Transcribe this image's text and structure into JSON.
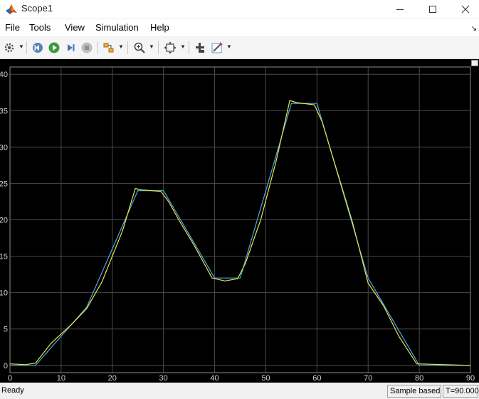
{
  "window": {
    "title": "Scope1"
  },
  "menu": {
    "items": [
      "File",
      "Tools",
      "View",
      "Simulation",
      "Help"
    ]
  },
  "toolbar": {
    "icons": [
      "gear-icon",
      "step-back-icon",
      "run-icon",
      "step-forward-icon",
      "stop-icon",
      "highlight-block-icon",
      "zoom-icon",
      "fit-to-view-icon",
      "cursor-measure-icon",
      "style-icon"
    ]
  },
  "colors": {
    "plot_bg": "#000000",
    "grid": "#4a4a4a",
    "axis": "#8c8c8c",
    "tick_text": "#d2d2d2",
    "series1": "#4da6e8",
    "series2": "#e6e64c"
  },
  "status": {
    "left": "Ready",
    "mode": "Sample based",
    "time": "T=90.000"
  },
  "chart_data": {
    "type": "line",
    "xlim": [
      0,
      90
    ],
    "ylim": [
      -1,
      41
    ],
    "xticks": [
      0,
      10,
      20,
      30,
      40,
      50,
      60,
      70,
      80,
      90
    ],
    "yticks": [
      0,
      5,
      10,
      15,
      20,
      25,
      30,
      35,
      40
    ],
    "grid": true,
    "series": [
      {
        "color": "#4da6e8",
        "x": [
          0,
          5,
          15,
          25,
          30,
          40,
          45,
          55,
          60,
          70,
          80,
          90
        ],
        "y": [
          0,
          0,
          8,
          24,
          24,
          12,
          12,
          36,
          36,
          12,
          0,
          0
        ]
      },
      {
        "color": "#e6e64c",
        "x": [
          0,
          3,
          5,
          6,
          8,
          12,
          15,
          18,
          22,
          24.5,
          26,
          29.5,
          31,
          33,
          36,
          39.5,
          42,
          44.5,
          46,
          49,
          52,
          54.7,
          56,
          59.5,
          61,
          64,
          67,
          70,
          73,
          76,
          79.5,
          90
        ],
        "y": [
          0.2,
          0.1,
          0.3,
          1.2,
          3,
          5.6,
          7.8,
          11.5,
          18.5,
          24.3,
          24.1,
          23.9,
          22.5,
          20,
          16.5,
          12,
          11.6,
          11.9,
          14,
          20,
          28,
          36.4,
          36.1,
          35.8,
          33.5,
          26.5,
          19.5,
          11.3,
          8.2,
          4,
          0.2,
          0
        ]
      }
    ]
  }
}
